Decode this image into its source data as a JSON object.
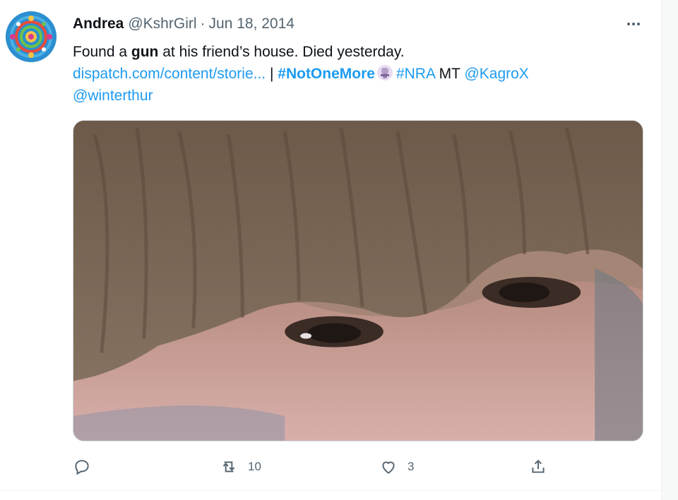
{
  "tweet": {
    "author": {
      "name": "Andrea",
      "handle": "@KshrGirl",
      "separator": "·",
      "date": "Jun 18, 2014"
    },
    "text": {
      "part1": "Found a ",
      "bold": "gun",
      "part2": " at his friend’s house. Died yesterday.",
      "link": "dispatch.com/content/storie...",
      "pipe": " | ",
      "hashtag1": "#NotOneMore",
      "hashtag2": "#NRA",
      "mt": " MT ",
      "mention1": "@KagroX",
      "mention2": "@winterthur"
    },
    "icons": {
      "more": "more-horizontal-icon",
      "reply": "reply-icon",
      "retweet": "retweet-icon",
      "like": "heart-icon",
      "share": "share-icon",
      "hashtag_emoji": "fist-emoji-icon"
    },
    "stats": {
      "retweets": "10",
      "likes": "3"
    },
    "colors": {
      "link": "#1d9bf0",
      "secondary": "#536471"
    }
  }
}
